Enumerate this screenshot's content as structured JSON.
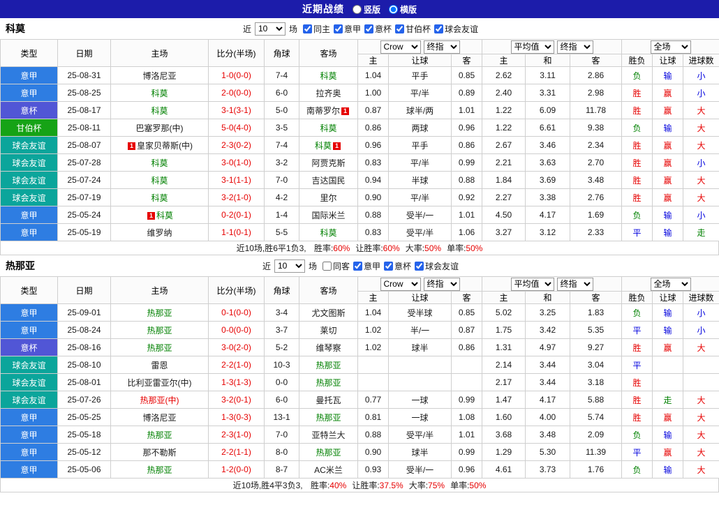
{
  "topbar": {
    "title": "近期战绩",
    "options": [
      {
        "label": "竖版",
        "selected": false
      },
      {
        "label": "横版",
        "selected": true
      }
    ]
  },
  "table_header": {
    "type": "类型",
    "date": "日期",
    "home": "主场",
    "score": "比分(半场)",
    "corner": "角球",
    "away": "客场",
    "odds_company_select": "Crow",
    "odds_stage_select": "终指",
    "avg_select": "平均值",
    "avg_stage_select": "终指",
    "scope_select": "全场",
    "sub": [
      "主",
      "让球",
      "客",
      "主",
      "和",
      "客",
      "胜负",
      "让球",
      "进球数"
    ]
  },
  "colors": {
    "topbar_bg": "#1c1caa",
    "league": {
      "意甲": "#2e7de2",
      "意杯": "#5156d6",
      "甘伯杯": "#16a316",
      "球会友谊": "#0ba59b"
    },
    "text": {
      "red": "#e60000",
      "green": "#008000",
      "blue": "#0000dd",
      "black": "#1a1a1a"
    }
  },
  "sections": [
    {
      "team": "科莫",
      "filter": {
        "prefix": "近",
        "count": "10",
        "suffix": "场",
        "checkboxes": [
          {
            "label": "同主",
            "key": "same-home",
            "checked": true
          },
          {
            "label": "意甲",
            "key": "serie-a",
            "checked": true
          },
          {
            "label": "意杯",
            "key": "coppa-italia",
            "checked": true
          },
          {
            "label": "甘伯杯",
            "key": "gamper",
            "checked": true
          },
          {
            "label": "球会友谊",
            "key": "club-friendly",
            "checked": true
          }
        ]
      },
      "rows": [
        {
          "type": "意甲",
          "date": "25-08-31",
          "home": {
            "name": "博洛尼亚",
            "color": "black"
          },
          "score": "1-0(0-0)",
          "corner": "7-4",
          "away": {
            "name": "科莫",
            "color": "green"
          },
          "odds": [
            "1.04",
            "平手",
            "0.85"
          ],
          "avg": [
            "2.62",
            "3.11",
            "2.86"
          ],
          "results": [
            {
              "t": "负",
              "c": "green"
            },
            {
              "t": "输",
              "c": "blue"
            },
            {
              "t": "小",
              "c": "blue"
            }
          ]
        },
        {
          "type": "意甲",
          "date": "25-08-25",
          "home": {
            "name": "科莫",
            "color": "green"
          },
          "score": "2-0(0-0)",
          "corner": "6-0",
          "away": {
            "name": "拉齐奥",
            "color": "black"
          },
          "odds": [
            "1.00",
            "平/半",
            "0.89"
          ],
          "avg": [
            "2.40",
            "3.31",
            "2.98"
          ],
          "results": [
            {
              "t": "胜",
              "c": "red"
            },
            {
              "t": "赢",
              "c": "red"
            },
            {
              "t": "小",
              "c": "blue"
            }
          ]
        },
        {
          "type": "意杯",
          "date": "25-08-17",
          "home": {
            "name": "科莫",
            "color": "green"
          },
          "score": "3-1(3-1)",
          "corner": "5-0",
          "away": {
            "name": "南蒂罗尔",
            "color": "black",
            "badge_after": "1"
          },
          "odds": [
            "0.87",
            "球半/两",
            "1.01"
          ],
          "avg": [
            "1.22",
            "6.09",
            "11.78"
          ],
          "results": [
            {
              "t": "胜",
              "c": "red"
            },
            {
              "t": "赢",
              "c": "red"
            },
            {
              "t": "大",
              "c": "red"
            }
          ]
        },
        {
          "type": "甘伯杯",
          "date": "25-08-11",
          "home": {
            "name": "巴塞罗那(中)",
            "color": "black"
          },
          "score": "5-0(4-0)",
          "corner": "3-5",
          "away": {
            "name": "科莫",
            "color": "green"
          },
          "odds": [
            "0.86",
            "两球",
            "0.96"
          ],
          "avg": [
            "1.22",
            "6.61",
            "9.38"
          ],
          "results": [
            {
              "t": "负",
              "c": "green"
            },
            {
              "t": "输",
              "c": "blue"
            },
            {
              "t": "大",
              "c": "red"
            }
          ]
        },
        {
          "type": "球会友谊",
          "date": "25-08-07",
          "home": {
            "name": "皇家贝蒂斯(中)",
            "color": "black",
            "badge_before": "1"
          },
          "score": "2-3(0-2)",
          "corner": "7-4",
          "away": {
            "name": "科莫",
            "color": "green",
            "badge_after": "1"
          },
          "odds": [
            "0.96",
            "平手",
            "0.86"
          ],
          "avg": [
            "2.67",
            "3.46",
            "2.34"
          ],
          "results": [
            {
              "t": "胜",
              "c": "red"
            },
            {
              "t": "赢",
              "c": "red"
            },
            {
              "t": "大",
              "c": "red"
            }
          ]
        },
        {
          "type": "球会友谊",
          "date": "25-07-28",
          "home": {
            "name": "科莫",
            "color": "green"
          },
          "score": "3-0(1-0)",
          "corner": "3-2",
          "away": {
            "name": "阿贾克斯",
            "color": "black"
          },
          "odds": [
            "0.83",
            "平/半",
            "0.99"
          ],
          "avg": [
            "2.21",
            "3.63",
            "2.70"
          ],
          "results": [
            {
              "t": "胜",
              "c": "red"
            },
            {
              "t": "赢",
              "c": "red"
            },
            {
              "t": "小",
              "c": "blue"
            }
          ]
        },
        {
          "type": "球会友谊",
          "date": "25-07-24",
          "home": {
            "name": "科莫",
            "color": "green"
          },
          "score": "3-1(1-1)",
          "corner": "7-0",
          "away": {
            "name": "吉达国民",
            "color": "black"
          },
          "odds": [
            "0.94",
            "半球",
            "0.88"
          ],
          "avg": [
            "1.84",
            "3.69",
            "3.48"
          ],
          "results": [
            {
              "t": "胜",
              "c": "red"
            },
            {
              "t": "赢",
              "c": "red"
            },
            {
              "t": "大",
              "c": "red"
            }
          ]
        },
        {
          "type": "球会友谊",
          "date": "25-07-19",
          "home": {
            "name": "科莫",
            "color": "green"
          },
          "score": "3-2(1-0)",
          "corner": "4-2",
          "away": {
            "name": "里尔",
            "color": "black"
          },
          "odds": [
            "0.90",
            "平/半",
            "0.92"
          ],
          "avg": [
            "2.27",
            "3.38",
            "2.76"
          ],
          "results": [
            {
              "t": "胜",
              "c": "red"
            },
            {
              "t": "赢",
              "c": "red"
            },
            {
              "t": "大",
              "c": "red"
            }
          ]
        },
        {
          "type": "意甲",
          "date": "25-05-24",
          "home": {
            "name": "科莫",
            "color": "green",
            "badge_before": "1"
          },
          "score": "0-2(0-1)",
          "corner": "1-4",
          "away": {
            "name": "国际米兰",
            "color": "black"
          },
          "odds": [
            "0.88",
            "受半/一",
            "1.01"
          ],
          "avg": [
            "4.50",
            "4.17",
            "1.69"
          ],
          "results": [
            {
              "t": "负",
              "c": "green"
            },
            {
              "t": "输",
              "c": "blue"
            },
            {
              "t": "小",
              "c": "blue"
            }
          ]
        },
        {
          "type": "意甲",
          "date": "25-05-19",
          "home": {
            "name": "维罗纳",
            "color": "black"
          },
          "score": "1-1(0-1)",
          "corner": "5-5",
          "away": {
            "name": "科莫",
            "color": "green"
          },
          "odds": [
            "0.83",
            "受平/半",
            "1.06"
          ],
          "avg": [
            "3.27",
            "3.12",
            "2.33"
          ],
          "results": [
            {
              "t": "平",
              "c": "blue"
            },
            {
              "t": "输",
              "c": "blue"
            },
            {
              "t": "走",
              "c": "green"
            }
          ]
        }
      ],
      "summary": {
        "prefix": "近10场,胜6平1负3, ",
        "stats": [
          {
            "label": "胜率:",
            "value": "60%"
          },
          {
            "label": "让胜率:",
            "value": "60%"
          },
          {
            "label": "大率:",
            "value": "50%"
          },
          {
            "label": "单率:",
            "value": "50%"
          }
        ]
      }
    },
    {
      "team": "热那亚",
      "filter": {
        "prefix": "近",
        "count": "10",
        "suffix": "场",
        "checkboxes": [
          {
            "label": "同客",
            "key": "same-away",
            "checked": false
          },
          {
            "label": "意甲",
            "key": "serie-a",
            "checked": true
          },
          {
            "label": "意杯",
            "key": "coppa-italia",
            "checked": true
          },
          {
            "label": "球会友谊",
            "key": "club-friendly",
            "checked": true
          }
        ]
      },
      "rows": [
        {
          "type": "意甲",
          "date": "25-09-01",
          "home": {
            "name": "热那亚",
            "color": "green"
          },
          "score": "0-1(0-0)",
          "corner": "3-4",
          "away": {
            "name": "尤文图斯",
            "color": "black"
          },
          "odds": [
            "1.04",
            "受半球",
            "0.85"
          ],
          "avg": [
            "5.02",
            "3.25",
            "1.83"
          ],
          "results": [
            {
              "t": "负",
              "c": "green"
            },
            {
              "t": "输",
              "c": "blue"
            },
            {
              "t": "小",
              "c": "blue"
            }
          ]
        },
        {
          "type": "意甲",
          "date": "25-08-24",
          "home": {
            "name": "热那亚",
            "color": "green"
          },
          "score": "0-0(0-0)",
          "corner": "3-7",
          "away": {
            "name": "莱切",
            "color": "black"
          },
          "odds": [
            "1.02",
            "半/一",
            "0.87"
          ],
          "avg": [
            "1.75",
            "3.42",
            "5.35"
          ],
          "results": [
            {
              "t": "平",
              "c": "blue"
            },
            {
              "t": "输",
              "c": "blue"
            },
            {
              "t": "小",
              "c": "blue"
            }
          ]
        },
        {
          "type": "意杯",
          "date": "25-08-16",
          "home": {
            "name": "热那亚",
            "color": "green"
          },
          "score": "3-0(2-0)",
          "corner": "5-2",
          "away": {
            "name": "维琴察",
            "color": "black"
          },
          "odds": [
            "1.02",
            "球半",
            "0.86"
          ],
          "avg": [
            "1.31",
            "4.97",
            "9.27"
          ],
          "results": [
            {
              "t": "胜",
              "c": "red"
            },
            {
              "t": "赢",
              "c": "red"
            },
            {
              "t": "大",
              "c": "red"
            }
          ]
        },
        {
          "type": "球会友谊",
          "date": "25-08-10",
          "home": {
            "name": "雷恩",
            "color": "black"
          },
          "score": "2-2(1-0)",
          "corner": "10-3",
          "away": {
            "name": "热那亚",
            "color": "green"
          },
          "odds": [
            "",
            "",
            ""
          ],
          "avg": [
            "2.14",
            "3.44",
            "3.04"
          ],
          "results": [
            {
              "t": "平",
              "c": "blue"
            },
            {
              "t": "",
              "c": "black"
            },
            {
              "t": "",
              "c": "black"
            }
          ]
        },
        {
          "type": "球会友谊",
          "date": "25-08-01",
          "home": {
            "name": "比利亚雷亚尔(中)",
            "color": "black"
          },
          "score": "1-3(1-3)",
          "corner": "0-0",
          "away": {
            "name": "热那亚",
            "color": "green"
          },
          "odds": [
            "",
            "",
            ""
          ],
          "avg": [
            "2.17",
            "3.44",
            "3.18"
          ],
          "results": [
            {
              "t": "胜",
              "c": "red"
            },
            {
              "t": "",
              "c": "black"
            },
            {
              "t": "",
              "c": "black"
            }
          ]
        },
        {
          "type": "球会友谊",
          "date": "25-07-26",
          "home": {
            "name": "热那亚(中)",
            "color": "red"
          },
          "score": "3-2(0-1)",
          "corner": "6-0",
          "away": {
            "name": "曼托瓦",
            "color": "black"
          },
          "odds": [
            "0.77",
            "一球",
            "0.99"
          ],
          "avg": [
            "1.47",
            "4.17",
            "5.88"
          ],
          "results": [
            {
              "t": "胜",
              "c": "red"
            },
            {
              "t": "走",
              "c": "green"
            },
            {
              "t": "大",
              "c": "red"
            }
          ]
        },
        {
          "type": "意甲",
          "date": "25-05-25",
          "home": {
            "name": "博洛尼亚",
            "color": "black"
          },
          "score": "1-3(0-3)",
          "corner": "13-1",
          "away": {
            "name": "热那亚",
            "color": "green"
          },
          "odds": [
            "0.81",
            "一球",
            "1.08"
          ],
          "avg": [
            "1.60",
            "4.00",
            "5.74"
          ],
          "results": [
            {
              "t": "胜",
              "c": "red"
            },
            {
              "t": "赢",
              "c": "red"
            },
            {
              "t": "大",
              "c": "red"
            }
          ]
        },
        {
          "type": "意甲",
          "date": "25-05-18",
          "home": {
            "name": "热那亚",
            "color": "green"
          },
          "score": "2-3(1-0)",
          "corner": "7-0",
          "away": {
            "name": "亚特兰大",
            "color": "black"
          },
          "odds": [
            "0.88",
            "受平/半",
            "1.01"
          ],
          "avg": [
            "3.68",
            "3.48",
            "2.09"
          ],
          "results": [
            {
              "t": "负",
              "c": "green"
            },
            {
              "t": "输",
              "c": "blue"
            },
            {
              "t": "大",
              "c": "red"
            }
          ]
        },
        {
          "type": "意甲",
          "date": "25-05-12",
          "home": {
            "name": "那不勒斯",
            "color": "black"
          },
          "score": "2-2(1-1)",
          "corner": "8-0",
          "away": {
            "name": "热那亚",
            "color": "green"
          },
          "odds": [
            "0.90",
            "球半",
            "0.99"
          ],
          "avg": [
            "1.29",
            "5.30",
            "11.39"
          ],
          "results": [
            {
              "t": "平",
              "c": "blue"
            },
            {
              "t": "赢",
              "c": "red"
            },
            {
              "t": "大",
              "c": "red"
            }
          ]
        },
        {
          "type": "意甲",
          "date": "25-05-06",
          "home": {
            "name": "热那亚",
            "color": "green"
          },
          "score": "1-2(0-0)",
          "corner": "8-7",
          "away": {
            "name": "AC米兰",
            "color": "black"
          },
          "odds": [
            "0.93",
            "受半/一",
            "0.96"
          ],
          "avg": [
            "4.61",
            "3.73",
            "1.76"
          ],
          "results": [
            {
              "t": "负",
              "c": "green"
            },
            {
              "t": "输",
              "c": "blue"
            },
            {
              "t": "大",
              "c": "red"
            }
          ]
        }
      ],
      "summary": {
        "prefix": "近10场,胜4平3负3, ",
        "stats": [
          {
            "label": "胜率:",
            "value": "40%"
          },
          {
            "label": "让胜率:",
            "value": "37.5%"
          },
          {
            "label": "大率:",
            "value": "75%"
          },
          {
            "label": "单率:",
            "value": "50%"
          }
        ]
      }
    }
  ]
}
